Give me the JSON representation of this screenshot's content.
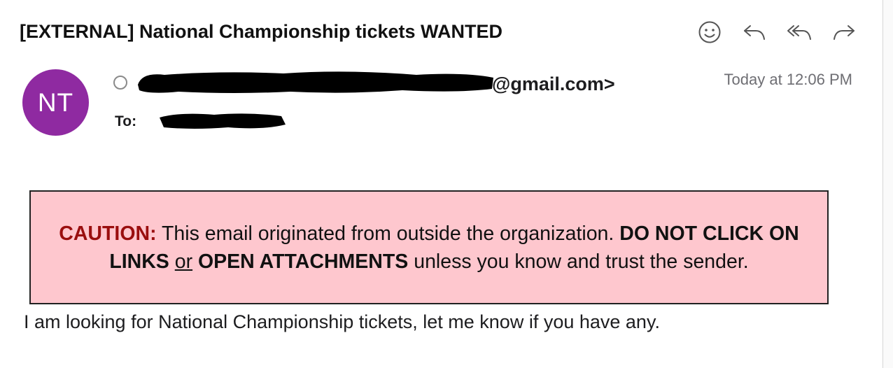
{
  "email": {
    "subject": "[EXTERNAL] National Championship tickets WANTED",
    "sender": {
      "avatar_initials": "NT",
      "avatar_color": "#8f2aa1",
      "address_suffix": "@gmail.com>"
    },
    "date": "Today at 12:06 PM",
    "to_label": "To:",
    "caution": {
      "label": "CAUTION:",
      "text_1": " This email originated from outside the organization. ",
      "bold_1": "DO NOT CLICK ON LINKS",
      "connector": "or",
      "bold_2": "OPEN ATTACHMENTS",
      "text_2": " unless you know and trust the sender.",
      "background": "#fec7ce",
      "label_color": "#9a0e0e"
    },
    "body": "I am looking for National Championship tickets, let me know if you have any."
  },
  "toolbar": {
    "icons": [
      "smiley-icon",
      "reply-icon",
      "reply-all-icon",
      "forward-icon"
    ]
  }
}
